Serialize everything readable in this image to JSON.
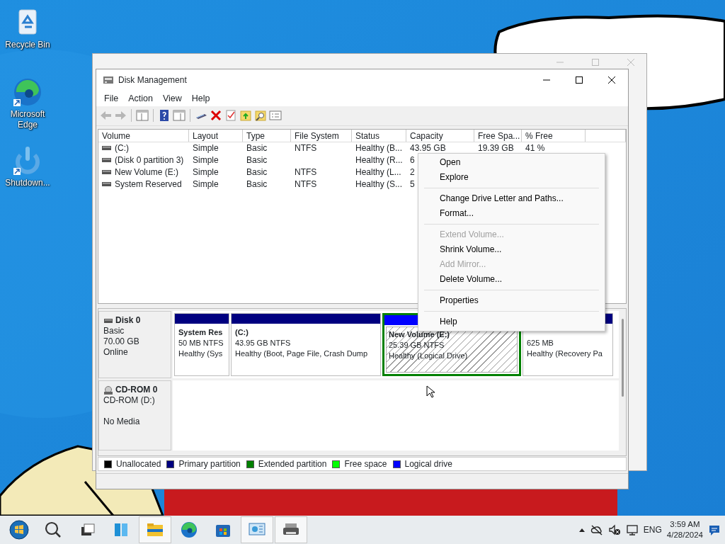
{
  "desktop_icons": [
    {
      "kind": "recycle",
      "label": "Recycle Bin"
    },
    {
      "kind": "edge",
      "label": "Microsoft Edge"
    },
    {
      "kind": "power",
      "label": "Shutdown..."
    }
  ],
  "window": {
    "title": "Disk Management",
    "menu": [
      "File",
      "Action",
      "View",
      "Help"
    ],
    "toolbar": [
      {
        "kind": "back",
        "disabled": true
      },
      {
        "kind": "forward",
        "disabled": true
      },
      {
        "kind": "sep"
      },
      {
        "kind": "tree"
      },
      {
        "kind": "sep"
      },
      {
        "kind": "help"
      },
      {
        "kind": "pane"
      },
      {
        "kind": "sep"
      },
      {
        "kind": "drive"
      },
      {
        "kind": "delete"
      },
      {
        "kind": "check"
      },
      {
        "kind": "folder"
      },
      {
        "kind": "search"
      },
      {
        "kind": "props"
      }
    ],
    "volume_table": {
      "columns": [
        "Volume",
        "Layout",
        "Type",
        "File System",
        "Status",
        "Capacity",
        "Free Spa...",
        "% Free"
      ],
      "rows": [
        {
          "cells": [
            "(C:)",
            "Simple",
            "Basic",
            "NTFS",
            "Healthy (B...",
            "43.95 GB",
            "19.39 GB",
            "41 %"
          ]
        },
        {
          "cells": [
            "(Disk 0 partition 3)",
            "Simple",
            "Basic",
            "",
            "Healthy (R...",
            "6",
            "",
            ""
          ]
        },
        {
          "cells": [
            "New Volume (E:)",
            "Simple",
            "Basic",
            "NTFS",
            "Healthy (L...",
            "2",
            "",
            ""
          ]
        },
        {
          "cells": [
            "System Reserved",
            "Simple",
            "Basic",
            "NTFS",
            "Healthy (S...",
            "5",
            "",
            ""
          ]
        }
      ]
    },
    "disks": [
      {
        "kind": "basic",
        "name": "Disk 0",
        "lines": [
          "Basic",
          "70.00 GB"
        ],
        "status": "Online",
        "partitions": [
          {
            "kind": "primary",
            "selected": false,
            "name": "System Res",
            "lines": [
              "50 MB NTFS",
              "Healthy (Sys"
            ]
          },
          {
            "kind": "primary",
            "selected": false,
            "name": "(C:)",
            "lines": [
              "43.95 GB NTFS",
              "Healthy (Boot, Page File, Crash Dump"
            ]
          },
          {
            "kind": "logical",
            "selected": true,
            "name": "New Volume  (E:)",
            "lines": [
              "25.39 GB NTFS",
              "Healthy (Logical Drive)"
            ]
          },
          {
            "kind": "primary",
            "selected": false,
            "lines": [
              "625 MB",
              "Healthy (Recovery Pa"
            ]
          }
        ]
      },
      {
        "kind": "cdrom",
        "name": "CD-ROM 0",
        "lines": [
          "CD-ROM (D:)"
        ],
        "status": "No Media"
      }
    ],
    "legend": [
      {
        "label": "Unallocated",
        "color": "#000000"
      },
      {
        "label": "Primary partition",
        "color": "#000080"
      },
      {
        "label": "Extended partition",
        "color": "#008000"
      },
      {
        "label": "Free space",
        "color": "#00ff00"
      },
      {
        "label": "Logical drive",
        "color": "#0000ff"
      }
    ]
  },
  "context_menu": [
    {
      "kind": "item",
      "label": "Open",
      "disabled": false
    },
    {
      "kind": "item",
      "label": "Explore",
      "disabled": false
    },
    {
      "kind": "separator"
    },
    {
      "kind": "item",
      "label": "Change Drive Letter and Paths...",
      "disabled": false
    },
    {
      "kind": "item",
      "label": "Format...",
      "disabled": false
    },
    {
      "kind": "separator"
    },
    {
      "kind": "item",
      "label": "Extend Volume...",
      "disabled": true
    },
    {
      "kind": "item",
      "label": "Shrink Volume...",
      "disabled": false
    },
    {
      "kind": "item",
      "label": "Add Mirror...",
      "disabled": true
    },
    {
      "kind": "item",
      "label": "Delete Volume...",
      "disabled": false
    },
    {
      "kind": "separator"
    },
    {
      "kind": "item",
      "label": "Properties",
      "disabled": false
    },
    {
      "kind": "separator"
    },
    {
      "kind": "item",
      "label": "Help",
      "disabled": false
    }
  ],
  "taskbar": {
    "apps": [
      {
        "kind": "start",
        "open": false
      },
      {
        "kind": "search",
        "open": false
      },
      {
        "kind": "taskview",
        "open": false
      },
      {
        "kind": "widgets",
        "open": false
      },
      {
        "kind": "explorer",
        "open": true
      },
      {
        "kind": "edge",
        "open": false
      },
      {
        "kind": "store",
        "open": false
      },
      {
        "kind": "diskmgmt",
        "open": true
      },
      {
        "kind": "printer",
        "open": true
      }
    ],
    "language": "ENG",
    "time": "3:59 AM",
    "date": "4/28/2024"
  }
}
